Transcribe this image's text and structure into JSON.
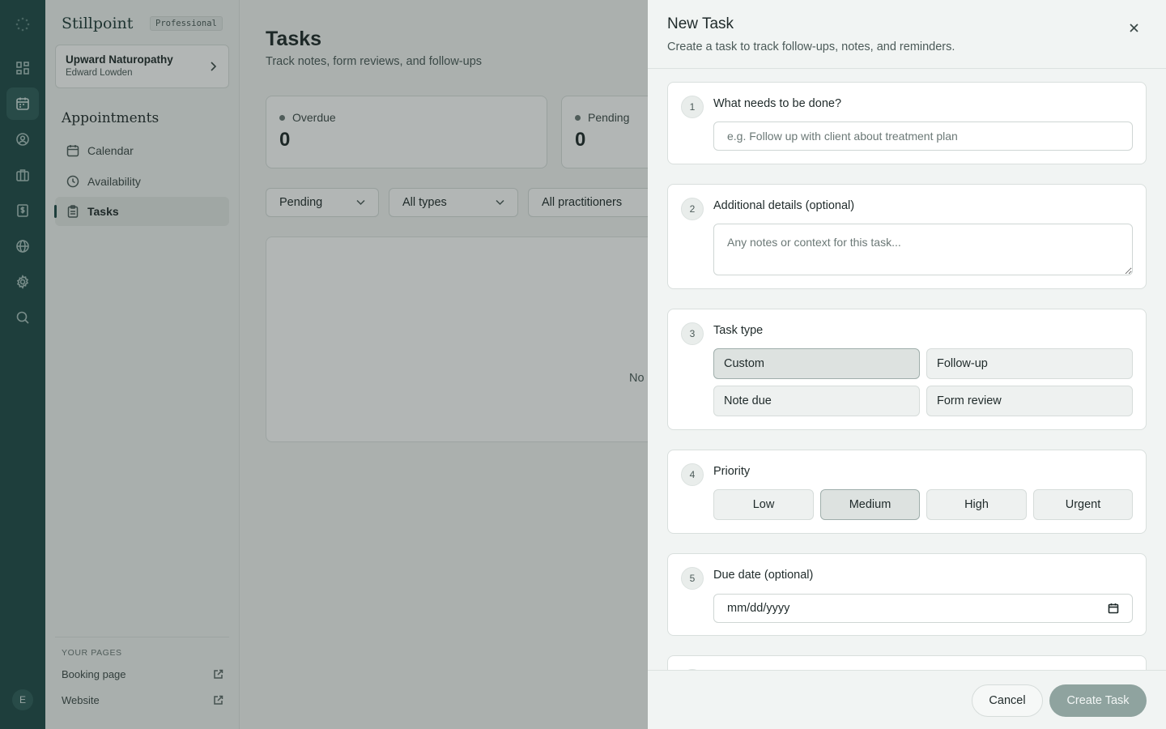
{
  "rail": {
    "icons": [
      "logo-icon",
      "dashboard-icon",
      "calendar-icon",
      "client-icon",
      "briefcase-icon",
      "billing-icon",
      "globe-icon",
      "gear-icon",
      "search-icon"
    ],
    "avatar_initial": "E"
  },
  "sidebar": {
    "brand": "Stillpoint",
    "plan_badge": "Professional",
    "workspace": {
      "name": "Upward Naturopathy",
      "user": "Edward Lowden"
    },
    "section_title": "Appointments",
    "items": [
      {
        "label": "Calendar",
        "icon": "calendar-icon"
      },
      {
        "label": "Availability",
        "icon": "clock-icon"
      },
      {
        "label": "Tasks",
        "icon": "clipboard-icon",
        "active": true
      }
    ],
    "pages_label": "YOUR PAGES",
    "pages": [
      {
        "label": "Booking page",
        "icon": "external-link-icon"
      },
      {
        "label": "Website",
        "icon": "external-link-icon"
      }
    ]
  },
  "main": {
    "title": "Tasks",
    "subtitle": "Track notes, form reviews, and follow-ups",
    "stats": [
      {
        "label": "Overdue",
        "value": "0"
      },
      {
        "label": "Pending",
        "value": "0"
      }
    ],
    "filters": [
      {
        "value": "Pending"
      },
      {
        "value": "All types"
      },
      {
        "value": "All practitioners"
      }
    ],
    "empty_text": "No"
  },
  "drawer": {
    "title": "New Task",
    "subtitle": "Create a task to track follow-ups, notes, and reminders.",
    "steps": {
      "s1": {
        "num": "1",
        "title": "What needs to be done?",
        "placeholder": "e.g. Follow up with client about treatment plan",
        "value": ""
      },
      "s2": {
        "num": "2",
        "title": "Additional details (optional)",
        "placeholder": "Any notes or context for this task...",
        "value": ""
      },
      "s3": {
        "num": "3",
        "title": "Task type",
        "options": [
          "Custom",
          "Follow-up",
          "Note due",
          "Form review"
        ],
        "selected": "Custom"
      },
      "s4": {
        "num": "4",
        "title": "Priority",
        "options": [
          "Low",
          "Medium",
          "High",
          "Urgent"
        ],
        "selected": "Medium"
      },
      "s5": {
        "num": "5",
        "title": "Due date (optional)",
        "value": "mm/dd/yyyy"
      }
    },
    "footer": {
      "cancel": "Cancel",
      "create": "Create Task"
    }
  },
  "colors": {
    "rail": "#1f4a48",
    "overlay": "rgba(30,40,38,0.34)",
    "primary_disabled": "#8fa39f"
  }
}
